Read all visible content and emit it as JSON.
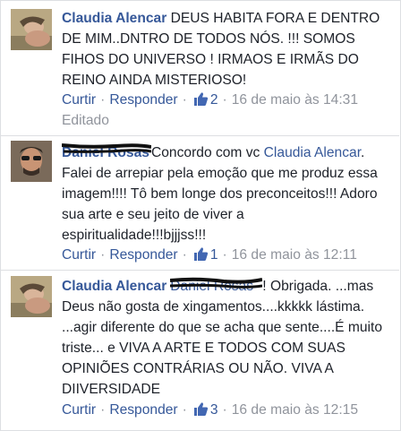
{
  "colors": {
    "link": "#365899",
    "meta": "#90949c",
    "text": "#1d2129",
    "divider": "#dddfe2"
  },
  "comments": [
    {
      "author": "Claudia Alencar",
      "redacted": "",
      "mention": "",
      "text": " DEUS HABITA FORA E DENTRO DE MIM..DNTRO DE TODOS NÓS. !!! SOMOS FIHOS DO UNIVERSO ! IRMAOS E IRMÃS DO REINO AINDA MISTERIOSO!",
      "text_after": "",
      "like_label": "Curtir",
      "reply_label": "Responder",
      "like_count": "2",
      "timestamp": "16 de maio às 14:31",
      "edited": "Editado"
    },
    {
      "author": "",
      "redacted": "Daniel Rosas",
      "mention_prefix": "Concordo com vc ",
      "mention": "Claudia Alencar",
      "text": ". Falei de arrepiar pela emoção que me produz essa imagem!!!! Tô bem longe dos preconceitos!!! Adoro sua arte e seu jeito de viver a espiritualidade!!!bjjjss!!!",
      "like_label": "Curtir",
      "reply_label": "Responder",
      "like_count": "1",
      "timestamp": "16 de maio às 12:11"
    },
    {
      "author": "Claudia Alencar",
      "redacted": "Daniel Rosas",
      "text": "! Obrigada. ...mas Deus não gosta de xingamentos....kkkkk lástima. ...agir diferente do que se acha que sente....É muito triste... e VIVA A ARTE E TODOS COM SUAS OPINIÕES CONTRÁRIAS OU NÃO. VIVA A DIIVERSIDADE",
      "like_label": "Curtir",
      "reply_label": "Responder",
      "like_count": "3",
      "timestamp": "16 de maio às 12:15"
    }
  ]
}
